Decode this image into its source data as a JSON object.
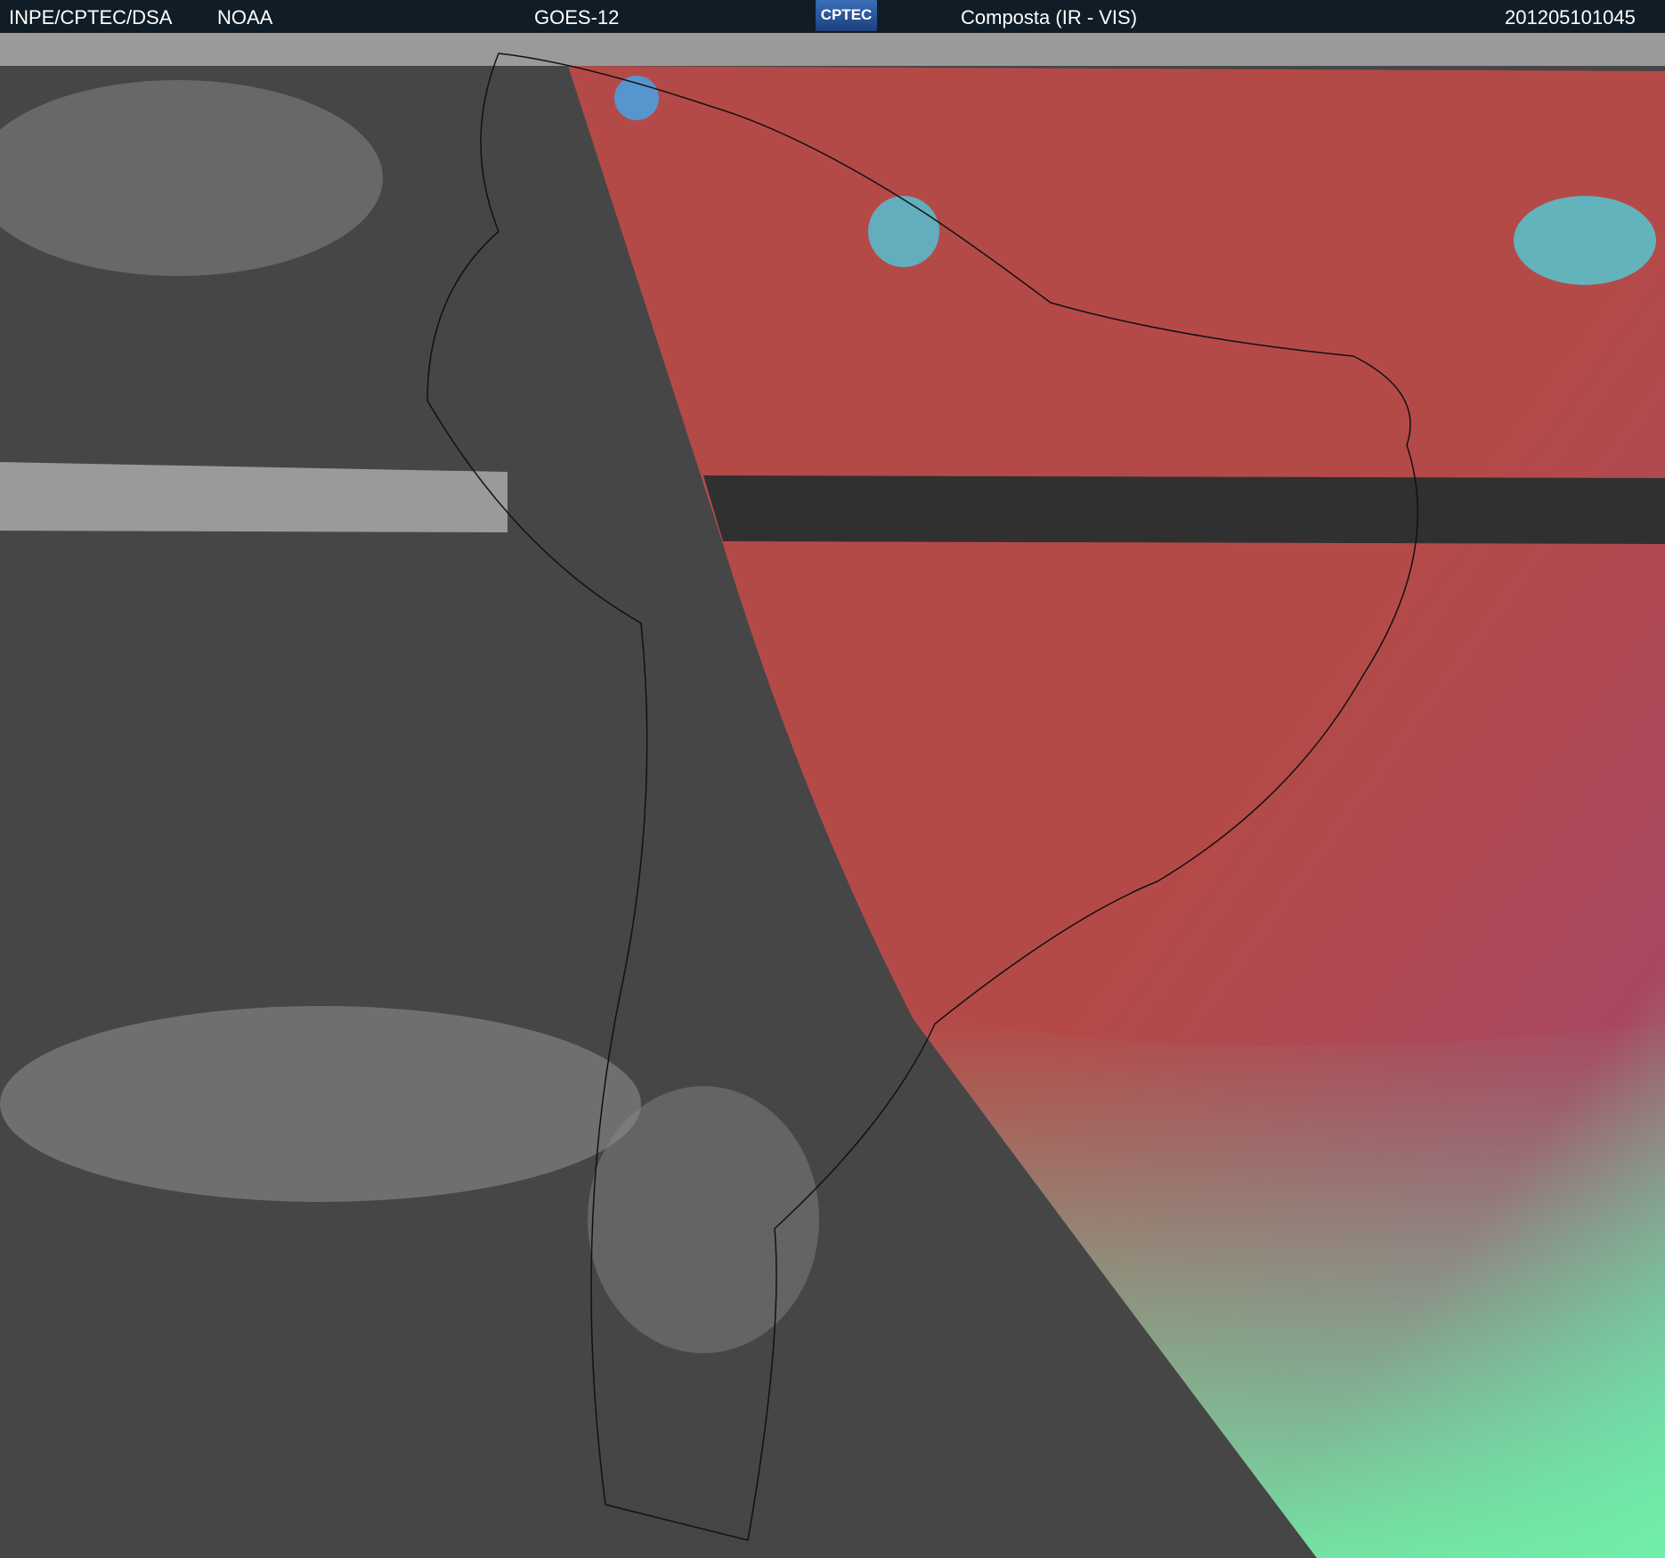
{
  "header": {
    "org": "INPE/CPTEC/DSA",
    "agency": "NOAA",
    "satellite": "GOES-12",
    "logo_text": "CPTEC",
    "product": "Composta (IR - VIS)",
    "timestamp": "201205101045"
  },
  "colors": {
    "header_bg": "#111d26",
    "ir_gray": "#4a4a4a",
    "composite_red": "#b84a45",
    "cloud_cyan": "#40e0f0",
    "cloud_green": "#80f0a0"
  }
}
